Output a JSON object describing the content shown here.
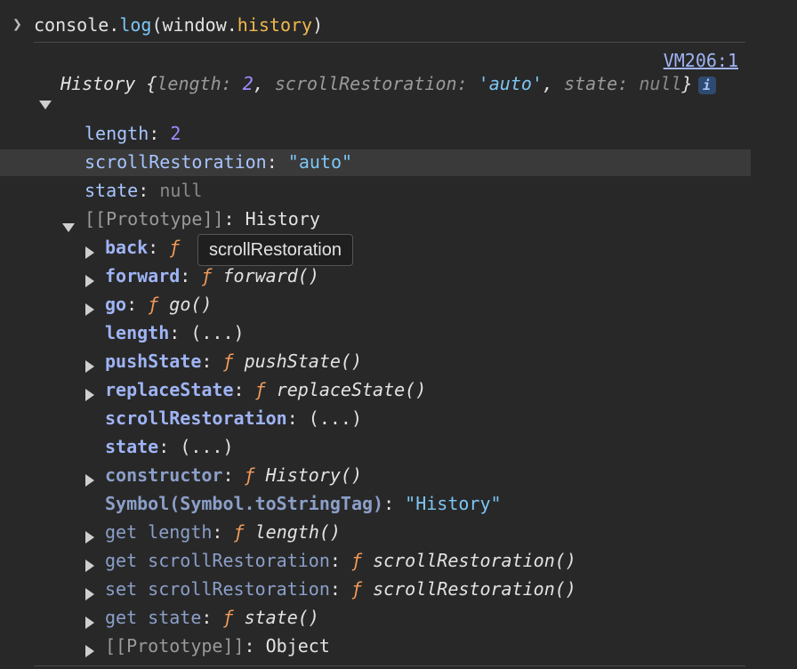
{
  "console": {
    "prompt_icon": "chevron-right-icon",
    "command": {
      "p1": "console.",
      "p2": "log",
      "p3": "(window.",
      "p4": "history",
      "p5": ")"
    },
    "source_link": "VM206:1"
  },
  "summary": {
    "label": "History {",
    "length_key": "length",
    "length_val": "2",
    "scroll_key": "scrollRestoration",
    "scroll_val": "'auto'",
    "state_key": "state",
    "state_val": "null",
    "close": "}",
    "info_icon": "i"
  },
  "props": {
    "length": {
      "key": "length",
      "val": "2"
    },
    "scroll": {
      "key": "scrollRestoration",
      "val": "\"auto\""
    },
    "state": {
      "key": "state",
      "val": "null"
    },
    "proto": {
      "key": "[[Prototype]]",
      "val": "History"
    }
  },
  "proto_items": {
    "back": {
      "key": "back",
      "f": "ƒ"
    },
    "forward": {
      "key": "forward",
      "f": "ƒ",
      "fn": "forward()"
    },
    "go": {
      "key": "go",
      "f": "ƒ",
      "fn": "go()"
    },
    "length": {
      "key": "length",
      "val": "(...)"
    },
    "pushState": {
      "key": "pushState",
      "f": "ƒ",
      "fn": "pushState()"
    },
    "replaceState": {
      "key": "replaceState",
      "f": "ƒ",
      "fn": "replaceState()"
    },
    "scroll": {
      "key": "scrollRestoration",
      "val": "(...)"
    },
    "state": {
      "key": "state",
      "val": "(...)"
    },
    "constructor": {
      "key": "constructor",
      "f": "ƒ",
      "fn": "History()"
    },
    "symbol": {
      "key": "Symbol(Symbol.toStringTag)",
      "val": "\"History\""
    },
    "get_length": {
      "key": "get length",
      "f": "ƒ",
      "fn": "length()"
    },
    "get_scroll": {
      "key": "get scrollRestoration",
      "f": "ƒ",
      "fn": "scrollRestoration()"
    },
    "set_scroll": {
      "key": "set scrollRestoration",
      "f": "ƒ",
      "fn": "scrollRestoration()"
    },
    "get_state": {
      "key": "get state",
      "f": "ƒ",
      "fn": "state()"
    },
    "proto": {
      "key": "[[Prototype]]",
      "val": "Object"
    }
  },
  "tooltip": "scrollRestoration"
}
